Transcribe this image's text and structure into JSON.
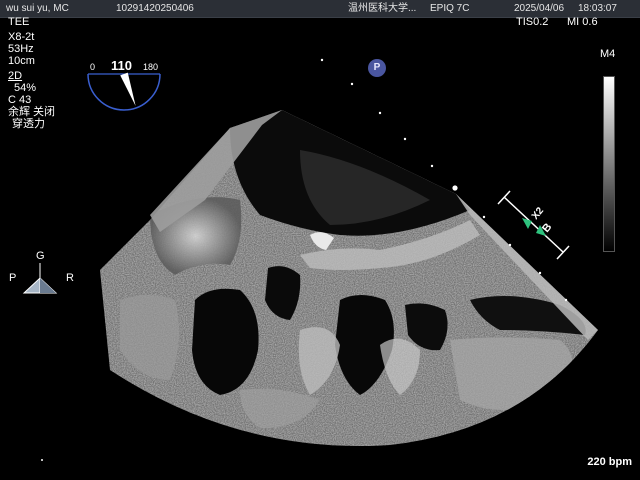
{
  "header": {
    "patient": "wu sui yu, MC",
    "patient_id": "10291420250406",
    "hospital": "温州医科大学...",
    "system": "EPIQ 7C",
    "date": "2025/04/06",
    "time": "18:03:07"
  },
  "left_info": {
    "mode": "TEE",
    "probe": "X8-2t",
    "frequency": "53Hz",
    "depth": "10cm",
    "imaging": "2D",
    "gain": "54%",
    "compression": "C 43",
    "setting_1": "余辉 关闭",
    "setting_2": "穿透力"
  },
  "right_info": {
    "tis": "TIS0.2",
    "mi": "MI 0.6",
    "map": "M4"
  },
  "angle_indicator": {
    "value": "110",
    "min_label": "0",
    "max_label": "180",
    "angle_degrees": 110
  },
  "orientation": {
    "top": "G",
    "left": "P",
    "right": "R"
  },
  "markers": {
    "p_marker": "P",
    "caliper_label": "B",
    "caliper_index": "X2"
  },
  "footer": {
    "heart_rate": "220 bpm"
  },
  "colors": {
    "topbar_bg": "#2b2f36",
    "p_marker_bg": "#4a56a0",
    "caliper_green": "#2ec27e",
    "tissue_gray": "#8a8a8a"
  }
}
